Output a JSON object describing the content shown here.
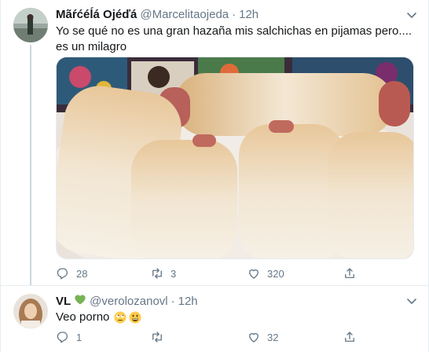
{
  "tweet1": {
    "display_name": "Mãŕćéĺá Ojéďá",
    "handle": "@Marcelitaojeda",
    "separator": "·",
    "time": "12h",
    "text": "Yo se qué no es una gran hazaña mis salchichas en pijamas pero.... es un milagro",
    "actions": {
      "reply_count": "28",
      "retweet_count": "3",
      "like_count": "320"
    }
  },
  "tweet2": {
    "display_name": "VL",
    "name_badge": "💚",
    "handle": "@verolozanovl",
    "separator": "·",
    "time": "12h",
    "text": "Veo porno",
    "emojis": [
      "rolling-eyes-emoji",
      "grinning-emoji"
    ],
    "actions": {
      "reply_count": "1",
      "retweet_count": "",
      "like_count": "32"
    }
  },
  "colors": {
    "text": "#14171a",
    "secondary": "#657786",
    "border": "#e6ecf0",
    "heart_green": "#77b255"
  },
  "icons": [
    "reply-icon",
    "retweet-icon",
    "like-icon",
    "share-icon",
    "caret-down-icon"
  ]
}
